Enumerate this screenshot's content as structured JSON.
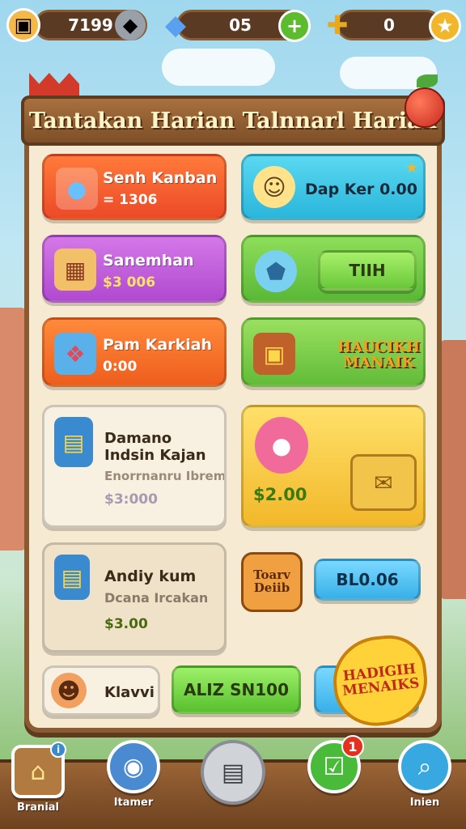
{
  "resources": {
    "coins": "7199",
    "gems": "05",
    "keys": "0"
  },
  "title": "Tantakan Harian Talnnarl Harian",
  "tasks": [
    {
      "title": "Senh Kanban",
      "reward": "= 1306"
    },
    {
      "title": "Dap Ker 0.00"
    },
    {
      "title": "Sanemhan",
      "reward": "$3 006"
    },
    {
      "button": "TIIH"
    },
    {
      "title": "Pam Karkiah",
      "reward": "0:00"
    },
    {
      "stamp": "HAUCIKH MANAIK"
    },
    {
      "title": "Damano Indsin Kajan",
      "subtitle": "Enorrnanru Ibrem",
      "reward": "$3:000"
    },
    {
      "reward": "$2.00"
    },
    {
      "title": "Andiy kum",
      "subtitle": "Dcana Ircakan",
      "reward": "$3.00"
    },
    {
      "stamp": "Toarv Deiib",
      "button": "BL0.06"
    },
    {
      "title": "Klavvi",
      "button": "ALIZ SN100",
      "stamp": "HADIGIH MENAIKS"
    }
  ],
  "nav": [
    {
      "label": "Branial"
    },
    {
      "label": "Itamer"
    },
    {
      "label": ""
    },
    {
      "label": "",
      "badge": "1"
    },
    {
      "label": "Inien"
    }
  ]
}
